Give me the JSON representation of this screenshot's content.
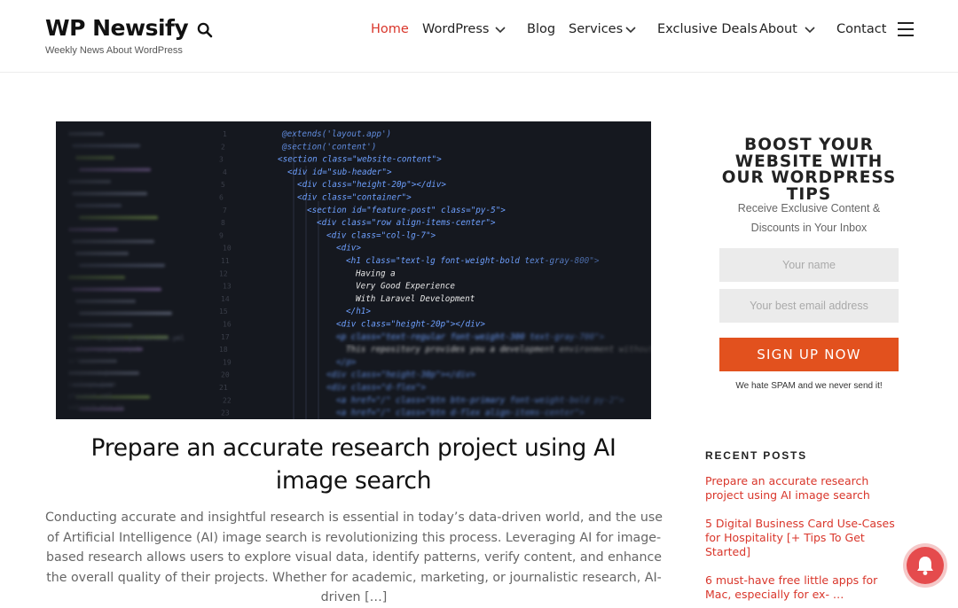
{
  "site": {
    "title": "WP Newsify",
    "tagline": "Weekly News About WordPress"
  },
  "nav": {
    "items": [
      {
        "label": "Home",
        "active": true,
        "dropdown": false
      },
      {
        "label": "WordPress",
        "active": false,
        "dropdown": true
      },
      {
        "label": "Blog",
        "active": false,
        "dropdown": false
      },
      {
        "label": "Services",
        "active": false,
        "dropdown": true
      },
      {
        "label": "Exclusive Deals",
        "active": false,
        "dropdown": false
      },
      {
        "label": "About",
        "active": false,
        "dropdown": true
      },
      {
        "label": "Contact",
        "active": false,
        "dropdown": false
      }
    ],
    "icons": {
      "search": "search-icon",
      "menu": "hamburger-menu-icon",
      "dropdown": "chevron-down-icon"
    }
  },
  "post": {
    "title": "Prepare an accurate research project using AI image search",
    "excerpt": "Conducting accurate and insightful research is essential in today’s data-driven world, and the use of Artificial Intelligence (AI) image search is revolutionizing this process. Leveraging AI for image-based research allows users to explore visual data, identify patterns, verify content, and enhance the overall quality of their projects. Whether for academic, marketing, or journalistic research, AI-driven […]",
    "image": {
      "code_lines": [
        "@extends('layout.app')",
        "@section('content')",
        "<section class=\"website-content\">",
        "<div id=\"sub-header\">",
        "<div class=\"height-20p\"></div>",
        "<div class=\"container\">",
        "<section id=\"feature-post\" class=\"py-5\">",
        "<div class=\"row align-items-center\">",
        "<div class=\"col-lg-7\">",
        "<div>",
        "<h1 class=\"text-lg font-weight-bold text-gray-800\">",
        "Having a",
        "Very Good Experience",
        "With Laravel Development",
        "</h1>",
        "<div class=\"height-20p\"></div>",
        "<p class=\"text-regular font-weight-300 text-gray-700\">",
        "This repository provides you a development environment without requiring",
        "</p>",
        "<div class=\"height-30p\"></div>",
        "<div class=\"d-flex\">",
        "<a href=\"/\" class=\"btn btn-primary font-weight-bold py-2\">",
        "<a href=\"/\" class=\"btn d-flex align-items-center\">"
      ],
      "sidebar_files": [
        "docker-compose.production.yml",
        "docker-compose.yml",
        "artisan",
        "composer.json",
        "package.json",
        "phpunit.xml",
        "webpack.mix.js"
      ]
    }
  },
  "sidebar": {
    "boost_title": "BOOST YOUR WEBSITE WITH OUR WORDPRESS TIPS",
    "boost_subtitle": "Receive Exclusive Content & Discounts in Your Inbox",
    "name_placeholder": "Your name",
    "email_placeholder": "Your best email address",
    "signup_label": "SIGN UP NOW",
    "spam_note": "We hate SPAM and we never send it!",
    "recent_title": "RECENT POSTS",
    "recent_posts": [
      "Prepare an accurate research project using AI image search",
      "5 Digital Business Card Use-Cases for Hospitality [+ Tips To Get Started]",
      "6 must-have free little apps for Mac, especially for ex- …"
    ]
  },
  "colors": {
    "accent": "#d9362b",
    "button": "#e2511e",
    "notification": "#e54b4d",
    "field_bg": "#ebebeb",
    "code_bg": "#15181f"
  },
  "notification": {
    "icon": "bell-icon"
  }
}
